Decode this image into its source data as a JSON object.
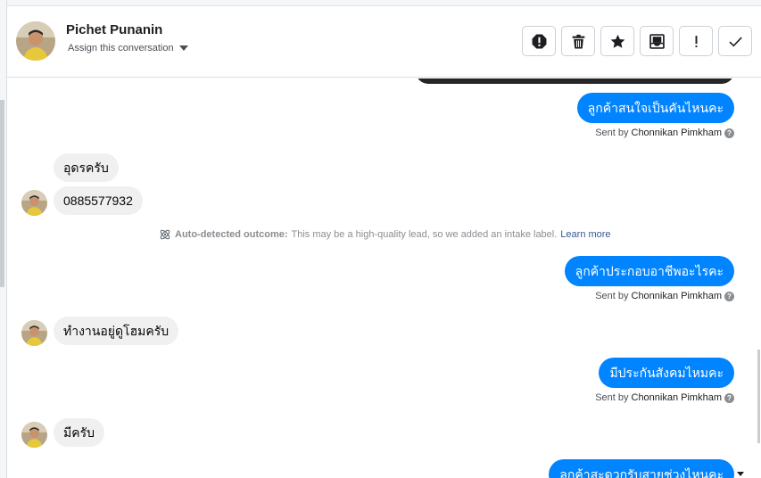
{
  "contact": {
    "name": "Pichet Punanin",
    "assign_label": "Assign this conversation"
  },
  "header_actions": [
    {
      "icon": "alert-icon",
      "name": "mark-spam-button"
    },
    {
      "icon": "trash-icon",
      "name": "delete-button"
    },
    {
      "icon": "star-icon",
      "name": "star-button"
    },
    {
      "icon": "archive-icon",
      "name": "archive-button"
    },
    {
      "icon": "exclamation-icon",
      "name": "mark-unread-button"
    },
    {
      "icon": "check-icon",
      "name": "mark-done-button"
    }
  ],
  "messages": {
    "m1": {
      "text": "ลูกค้าสนใจเป็นคันไหนคะ",
      "sent_by_prefix": "Sent by",
      "sender": "Chonnikan Pimkham"
    },
    "m2": {
      "text": "อุดรครับ"
    },
    "m3": {
      "text": "0885577932"
    },
    "notice": {
      "title": "Auto-detected outcome:",
      "body": "This may be a high-quality lead, so we added an intake label.",
      "link": "Learn more"
    },
    "m4": {
      "text": "ลูกค้าประกอบอาชีพอะไรคะ",
      "sent_by_prefix": "Sent by",
      "sender": "Chonnikan Pimkham"
    },
    "m5": {
      "text": "ทำงานอยู่ดูโฮมครับ"
    },
    "m6": {
      "text": "มีประกันสังคมไหมคะ",
      "sent_by_prefix": "Sent by",
      "sender": "Chonnikan Pimkham"
    },
    "m7": {
      "text": "มีครับ"
    },
    "m8": {
      "text": "ลูกค้าสะดวกรับสายช่วงไหนคะ"
    }
  },
  "colors": {
    "outgoing_bubble": "#0084ff",
    "incoming_bubble": "#f0f0f0",
    "link": "#385898"
  }
}
